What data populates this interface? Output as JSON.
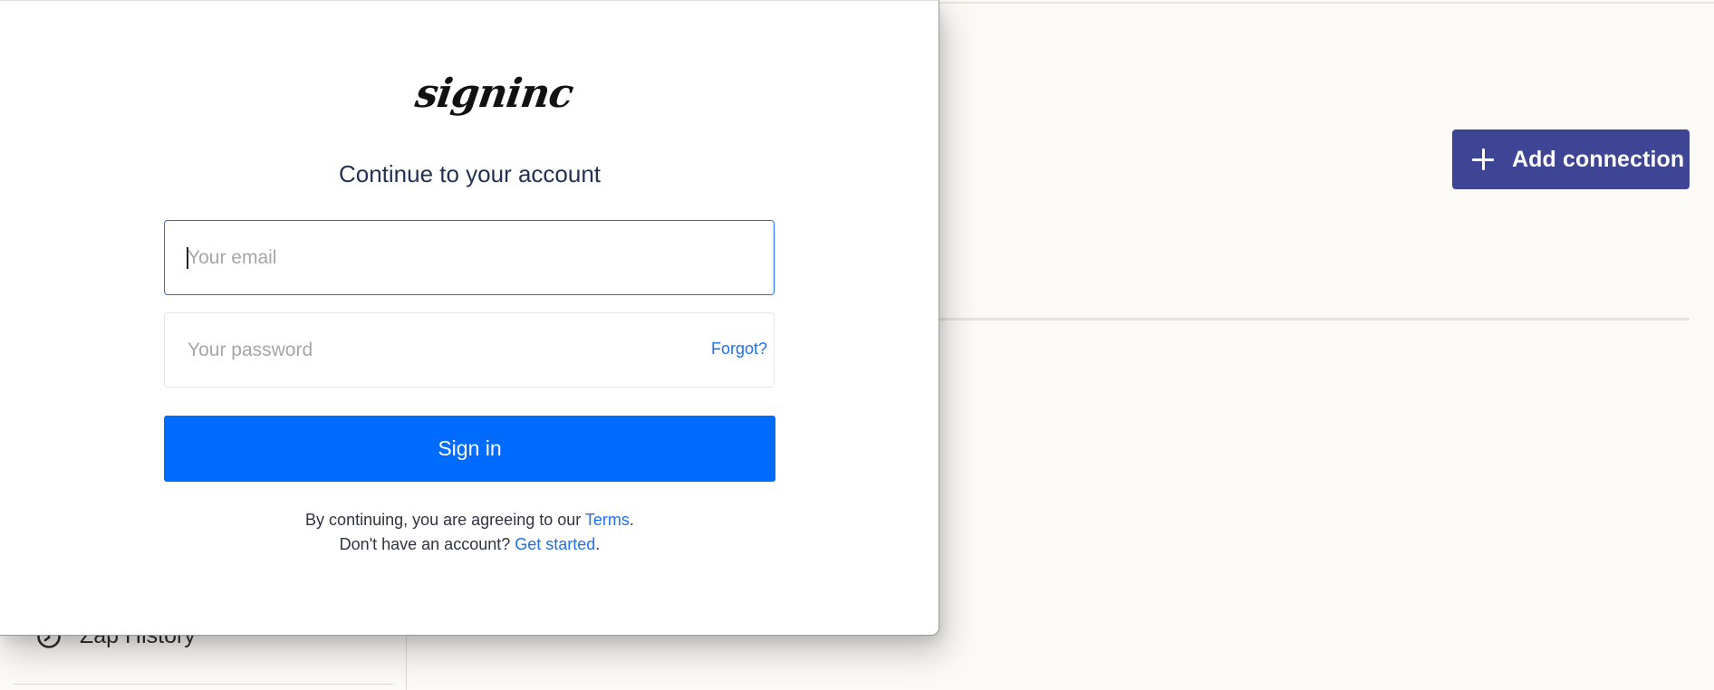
{
  "background": {
    "add_connection_label": "Add connection",
    "add_connection_icon": "plus-icon",
    "sidebar_items": [
      {
        "label": "Zap History",
        "icon": "history-icon"
      }
    ]
  },
  "modal": {
    "logo_text": "signinc",
    "heading": "Continue to your account",
    "email_placeholder": "Your email",
    "email_value": "",
    "password_placeholder": "Your password",
    "forgot_label": "Forgot?",
    "signin_label": "Sign in",
    "terms_prefix": "By continuing, you are agreeing to our ",
    "terms_link": "Terms",
    "terms_suffix": ".",
    "no_account_prefix": "Don't have an account? ",
    "get_started_link": "Get started",
    "get_started_suffix": "."
  },
  "colors": {
    "primary_blue": "#006bff",
    "link_blue": "#1f6ff2",
    "add_connection_bg": "#3d4594",
    "page_bg": "#fbfaf7",
    "heading_text": "#1f3254"
  }
}
